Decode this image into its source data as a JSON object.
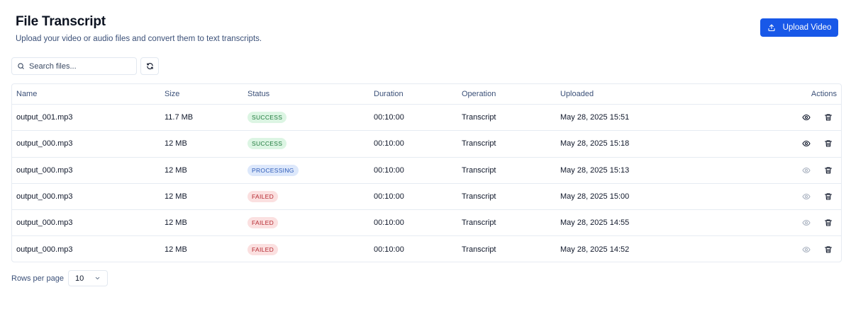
{
  "header": {
    "title": "File Transcript",
    "subtitle": "Upload your video or audio files and convert them to text transcripts.",
    "upload_label": "Upload Video"
  },
  "search": {
    "placeholder": "Search files...",
    "value": ""
  },
  "table": {
    "columns": {
      "name": "Name",
      "size": "Size",
      "status": "Status",
      "duration": "Duration",
      "operation": "Operation",
      "uploaded": "Uploaded",
      "actions": "Actions"
    },
    "rows": [
      {
        "name": "output_001.mp3",
        "size": "11.7 MB",
        "status": "SUCCESS",
        "duration": "00:10:00",
        "operation": "Transcript",
        "uploaded": "May 28, 2025 15:51"
      },
      {
        "name": "output_000.mp3",
        "size": "12 MB",
        "status": "SUCCESS",
        "duration": "00:10:00",
        "operation": "Transcript",
        "uploaded": "May 28, 2025 15:18"
      },
      {
        "name": "output_000.mp3",
        "size": "12 MB",
        "status": "PROCESSING",
        "duration": "00:10:00",
        "operation": "Transcript",
        "uploaded": "May 28, 2025 15:13"
      },
      {
        "name": "output_000.mp3",
        "size": "12 MB",
        "status": "FAILED",
        "duration": "00:10:00",
        "operation": "Transcript",
        "uploaded": "May 28, 2025 15:00"
      },
      {
        "name": "output_000.mp3",
        "size": "12 MB",
        "status": "FAILED",
        "duration": "00:10:00",
        "operation": "Transcript",
        "uploaded": "May 28, 2025 14:55"
      },
      {
        "name": "output_000.mp3",
        "size": "12 MB",
        "status": "FAILED",
        "duration": "00:10:00",
        "operation": "Transcript",
        "uploaded": "May 28, 2025 14:52"
      }
    ]
  },
  "pagination": {
    "rows_per_page_label": "Rows per page",
    "rows_per_page": "10"
  },
  "colors": {
    "accent": "#1858e8",
    "success": "#1f7a3d",
    "processing": "#2c5ab8",
    "failed": "#b4272f",
    "eye_enabled": "#0f172a",
    "eye_disabled": "#a9b2c0"
  },
  "icons": {
    "upload": "upload-icon",
    "search": "search-icon",
    "refresh": "refresh-icon",
    "view": "eye-icon",
    "delete": "trash-icon",
    "dropdown": "chevron-down-icon"
  }
}
